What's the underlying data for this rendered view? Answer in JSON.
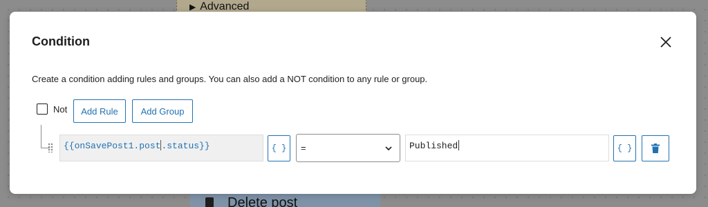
{
  "background": {
    "advanced_label": "Advanced",
    "delete_post_label": "Delete post"
  },
  "modal": {
    "title": "Condition",
    "close_icon": "close-icon",
    "description": "Create a condition adding rules and groups. You can also add a NOT condition to any rule or group.",
    "not_label": "Not",
    "not_checked": false,
    "add_rule_label": "Add Rule",
    "add_group_label": "Add Group"
  },
  "rule": {
    "expression_open": "{{",
    "expression_part1": "onSavePost1.post",
    "expression_part2": ".status",
    "expression_close": "}}",
    "brace_button_label": "{ }",
    "operator": "=",
    "value": "Published",
    "delete_icon": "trash-icon"
  },
  "colors": {
    "accent": "#2271b1",
    "text": "#1e1e1e"
  }
}
